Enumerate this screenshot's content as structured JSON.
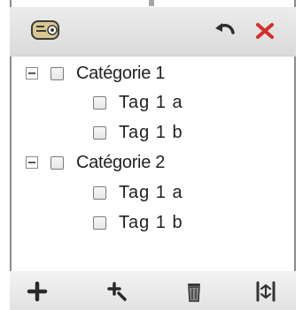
{
  "toolbar": {
    "icons": [
      "tag-icon",
      "undo-icon",
      "close-icon"
    ],
    "close_color": "#d2302a"
  },
  "tree": {
    "categories": [
      {
        "label": "Catégorie 1",
        "expanded": true,
        "checked": false,
        "tags": [
          {
            "label": "Tag 1 a",
            "checked": false
          },
          {
            "label": "Tag 1 b",
            "checked": false
          }
        ]
      },
      {
        "label": "Catégorie 2",
        "expanded": true,
        "checked": false,
        "tags": [
          {
            "label": "Tag 1 a",
            "checked": false
          },
          {
            "label": "Tag 1 b",
            "checked": false
          }
        ]
      }
    ]
  },
  "bottom_toolbar": {
    "icons": [
      "add-icon",
      "add-child-icon",
      "trash-icon",
      "expand-all-icon"
    ]
  }
}
